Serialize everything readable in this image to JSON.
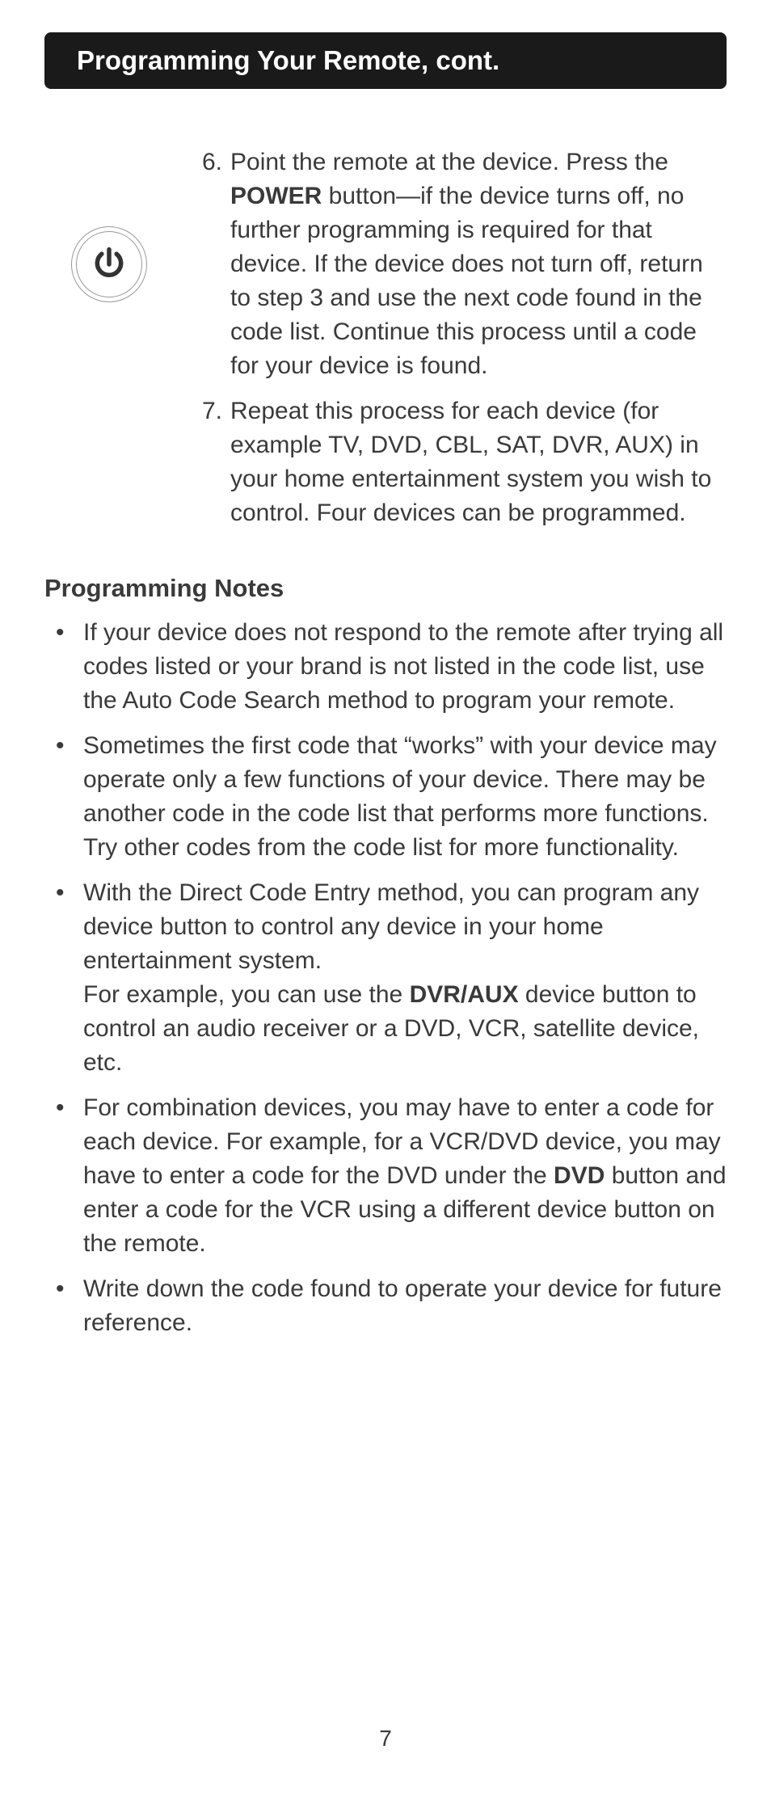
{
  "header": "Programming Your Remote, cont.",
  "steps": [
    {
      "num": "6.",
      "text_parts": [
        "Point the remote at the device. Press the ",
        "POWER",
        " button—if the device turns off, no further programming is required for that device. If the device does not turn off, return to step 3 and use the next code found in the code list. Continue this process until a code for your device is found."
      ]
    },
    {
      "num": "7.",
      "text_parts": [
        "Repeat this process for each device (for example TV, DVD, CBL, SAT, DVR, AUX) in your home entertainment system you wish to control. Four devices can be programmed."
      ]
    }
  ],
  "notes_heading": "Programming Notes",
  "notes": [
    {
      "text_parts": [
        "If your device does not respond to the remote after trying all codes listed or your brand is not listed in the code list, use the Auto Code Search method to program your remote."
      ]
    },
    {
      "text_parts": [
        "Sometimes the first code that “works” with your device may operate only a few functions of your device. There may be another code in the code list that performs more functions. Try other codes from the code list for more functionality."
      ]
    },
    {
      "text_parts": [
        "With the Direct Code Entry method, you can program any device button to control any device in your home entertainment system.\nFor example, you can use the ",
        "DVR/AUX",
        " device button to control an audio receiver or a DVD, VCR, satellite device, etc."
      ]
    },
    {
      "text_parts": [
        "For combination devices, you may have to enter a code for each device. For example, for a VCR/DVD device, you may have to enter a code for the DVD under the ",
        "DVD",
        " button and enter a code for the VCR using a different device button on the remote."
      ]
    },
    {
      "text_parts": [
        "Write down the code found to operate your device for future reference."
      ]
    }
  ],
  "page_number": "7"
}
